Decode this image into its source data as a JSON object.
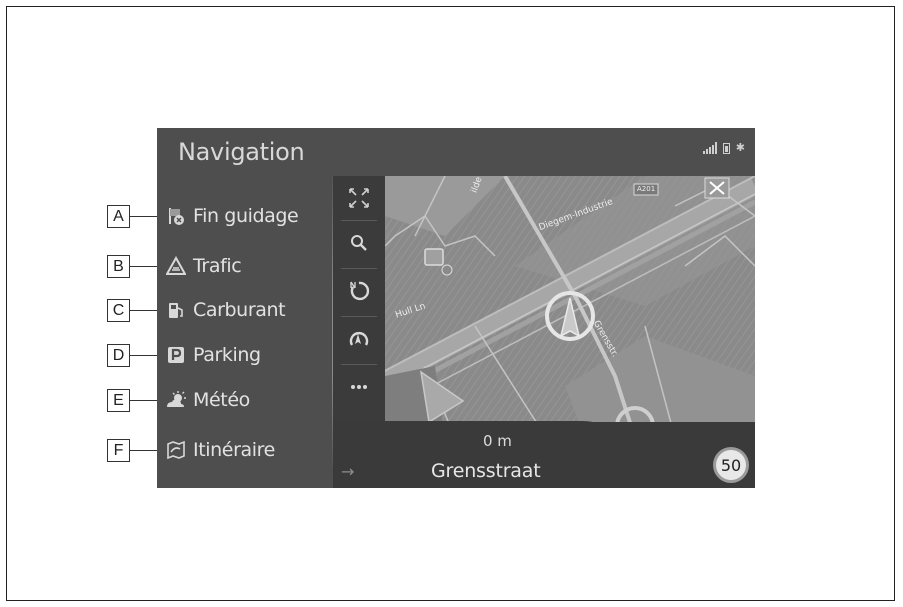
{
  "header": {
    "title": "Navigation"
  },
  "status_icons": [
    "signal-icon",
    "battery-icon",
    "bluetooth-icon"
  ],
  "menu": [
    {
      "callout": "A",
      "label": "Fin guidage",
      "icon": "end-guidance-icon"
    },
    {
      "callout": "B",
      "label": "Trafic",
      "icon": "traffic-icon"
    },
    {
      "callout": "C",
      "label": "Carburant",
      "icon": "fuel-icon"
    },
    {
      "callout": "D",
      "label": "Parking",
      "icon": "parking-icon"
    },
    {
      "callout": "E",
      "label": "Météo",
      "icon": "weather-icon"
    },
    {
      "callout": "F",
      "label": "Itinéraire",
      "icon": "route-icon"
    }
  ],
  "toolbar": [
    "fullscreen-icon",
    "search-icon",
    "north-up-icon",
    "reroute-icon",
    "more-icon"
  ],
  "map": {
    "road_labels": [
      "Diegem-Industrie",
      "A201",
      "Grensstr.",
      "Hull Ln",
      "ilde"
    ]
  },
  "guidance": {
    "distance": "0 m",
    "street": "Grensstraat",
    "speed_limit": "50"
  },
  "colors": {
    "screen_bg": "#4e4e4e",
    "map_bg": "#8c8c8c",
    "text": "#e2e2e2"
  }
}
